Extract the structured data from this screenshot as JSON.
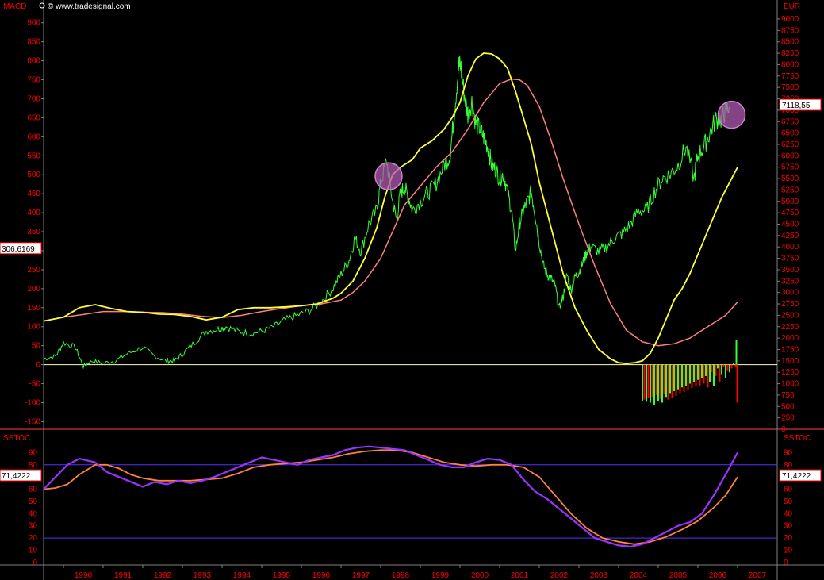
{
  "watermark": "© www.tradesignal.com",
  "colors": {
    "background": "#000000",
    "axis_text": "#ff0000",
    "price": "#33ff33",
    "macd": "#ffff33",
    "macd_signal": "#ff7f7f",
    "histogram_pos": "#33ff33",
    "histogram_neg": "#ff0000",
    "zero_line": "#ffffbb",
    "stoch_k": "#9933ff",
    "stoch_d": "#ff8040",
    "stoch_bands": "#5533ff",
    "highlight": "#b05ab0"
  },
  "top_panel": {
    "left_title": "MACD",
    "right_title": "EUR",
    "left_readout": "306,6169",
    "right_readout": "7118,55",
    "left_ticks": [
      "900",
      "850",
      "800",
      "750",
      "700",
      "650",
      "600",
      "550",
      "500",
      "450",
      "400",
      "350",
      "300",
      "250",
      "200",
      "150",
      "100",
      "50",
      "0",
      "-50",
      "-100",
      "-150"
    ],
    "right_ticks": [
      "9000",
      "8750",
      "8500",
      "8250",
      "8000",
      "7750",
      "7500",
      "7250",
      "7000",
      "6750",
      "6500",
      "6250",
      "6000",
      "5750",
      "5500",
      "5250",
      "5000",
      "4750",
      "4500",
      "4250",
      "4000",
      "3750",
      "3500",
      "3250",
      "3000",
      "2750",
      "2500",
      "2250",
      "2000",
      "1750",
      "1500",
      "1250",
      "1000",
      "750",
      "500",
      "250",
      "0"
    ]
  },
  "bottom_panel": {
    "left_title": "SSTOC",
    "right_title": "SSTOC",
    "left_readout": "71,4222",
    "right_readout": "71,4222",
    "ticks": [
      "90",
      "80",
      "70",
      "60",
      "50",
      "40",
      "30",
      "20",
      "10",
      "0"
    ]
  },
  "x_axis": {
    "years": [
      "1990",
      "1991",
      "1992",
      "1993",
      "1994",
      "1995",
      "1996",
      "1997",
      "1998",
      "1999",
      "2000",
      "2001",
      "2002",
      "2003",
      "2004",
      "2005",
      "2006",
      "2007"
    ]
  },
  "chart_data": [
    {
      "type": "line",
      "name": "top",
      "x_range": [
        1989.5,
        2008.0
      ],
      "y_left_range": [
        -170,
        960
      ],
      "y_right_range": [
        0,
        9000
      ],
      "price_series": {
        "axis": "right",
        "x": [
          1989.5,
          1989.8,
          1990.0,
          1990.3,
          1990.5,
          1990.7,
          1991.0,
          1991.3,
          1991.6,
          1992.0,
          1992.3,
          1992.6,
          1992.8,
          1993.0,
          1993.3,
          1993.6,
          1993.9,
          1994.1,
          1994.4,
          1994.7,
          1995.0,
          1995.3,
          1995.6,
          1995.9,
          1996.2,
          1996.5,
          1996.8,
          1997.0,
          1997.2,
          1997.35,
          1997.5,
          1997.7,
          1997.9,
          1998.0,
          1998.15,
          1998.3,
          1998.4,
          1998.5,
          1998.6,
          1998.7,
          1998.8,
          1999.0,
          1999.2,
          1999.4,
          1999.6,
          1999.75,
          1999.85,
          1999.95,
          2000.0,
          2000.1,
          2000.2,
          2000.3,
          2000.4,
          2000.5,
          2000.6,
          2000.7,
          2000.8,
          2000.9,
          2001.0,
          2001.1,
          2001.2,
          2001.3,
          2001.4,
          2001.5,
          2001.6,
          2001.7,
          2001.8,
          2001.9,
          2002.0,
          2002.1,
          2002.2,
          2002.3,
          2002.4,
          2002.5,
          2002.6,
          2002.7,
          2002.8,
          2002.9,
          2003.0,
          2003.1,
          2003.2,
          2003.3,
          2003.5,
          2003.7,
          2003.9,
          2004.1,
          2004.3,
          2004.5,
          2004.7,
          2004.9,
          2005.1,
          2005.3,
          2005.5,
          2005.7,
          2005.9,
          2006.0,
          2006.15,
          2006.3,
          2006.45,
          2006.6,
          2006.7,
          2006.8,
          2006.9,
          2006.95,
          2007.0
        ],
        "y": [
          1550,
          1600,
          1900,
          1800,
          1380,
          1500,
          1450,
          1500,
          1650,
          1800,
          1600,
          1500,
          1500,
          1650,
          1900,
          2150,
          2200,
          2250,
          2150,
          2100,
          2150,
          2250,
          2400,
          2500,
          2600,
          2800,
          3100,
          3400,
          3700,
          4200,
          3900,
          4500,
          4800,
          5400,
          5900,
          5000,
          4600,
          5200,
          5300,
          5100,
          4800,
          5000,
          5200,
          5400,
          5800,
          6000,
          6900,
          7800,
          8100,
          7400,
          6900,
          7200,
          6700,
          6600,
          6400,
          6200,
          5800,
          5700,
          5500,
          5600,
          5200,
          4800,
          3900,
          4500,
          4800,
          5000,
          5200,
          4700,
          4100,
          3600,
          3400,
          3300,
          3150,
          2650,
          2900,
          3400,
          3050,
          3350,
          3450,
          3650,
          3900,
          4000,
          3900,
          4000,
          4200,
          4300,
          4500,
          4800,
          4800,
          5200,
          5500,
          5600,
          5800,
          6200,
          5500,
          6000,
          6200,
          6500,
          6800,
          6800,
          7000,
          7118
        ]
      },
      "macd_series": {
        "axis": "left",
        "x": [
          1989.5,
          1990.0,
          1990.4,
          1990.8,
          1991.2,
          1991.6,
          1992.0,
          1992.4,
          1992.8,
          1993.2,
          1993.6,
          1994.0,
          1994.4,
          1994.8,
          1995.2,
          1995.6,
          1996.0,
          1996.4,
          1996.8,
          1997.0,
          1997.3,
          1997.6,
          1997.9,
          1998.1,
          1998.3,
          1998.5,
          1998.8,
          1999.0,
          1999.3,
          1999.6,
          1999.8,
          2000.0,
          2000.2,
          2000.4,
          2000.6,
          2000.8,
          2001.0,
          2001.2,
          2001.4,
          2001.6,
          2001.8,
          2002.0,
          2002.3,
          2002.6,
          2002.9,
          2003.2,
          2003.5,
          2003.8,
          2004.0,
          2004.2,
          2004.4,
          2004.6,
          2004.8,
          2005.0,
          2005.2,
          2005.4,
          2005.6,
          2005.8,
          2006.0,
          2006.2,
          2006.4,
          2006.6,
          2006.8,
          2007.0
        ],
        "y": [
          115,
          125,
          150,
          158,
          148,
          140,
          138,
          133,
          132,
          127,
          118,
          125,
          145,
          150,
          150,
          152,
          155,
          160,
          175,
          188,
          220,
          280,
          360,
          440,
          500,
          520,
          540,
          570,
          590,
          620,
          650,
          690,
          760,
          805,
          820,
          818,
          805,
          780,
          720,
          650,
          580,
          480,
          360,
          240,
          150,
          90,
          40,
          15,
          5,
          3,
          5,
          10,
          30,
          70,
          120,
          170,
          200,
          240,
          290,
          340,
          390,
          440,
          480,
          520
        ]
      },
      "signal_series": {
        "axis": "left",
        "x": [
          1989.5,
          1990.0,
          1990.5,
          1991.0,
          1991.5,
          1992.0,
          1992.5,
          1993.0,
          1993.5,
          1994.0,
          1994.5,
          1995.0,
          1995.5,
          1996.0,
          1996.5,
          1997.0,
          1997.3,
          1997.6,
          1998.0,
          1998.3,
          1998.6,
          1999.0,
          1999.4,
          1999.8,
          2000.2,
          2000.6,
          2001.0,
          2001.3,
          2001.5,
          2001.7,
          2002.0,
          2002.3,
          2002.6,
          2003.0,
          2003.4,
          2003.8,
          2004.2,
          2004.6,
          2005.0,
          2005.4,
          2005.8,
          2006.1,
          2006.4,
          2006.7,
          2007.0
        ],
        "y": [
          115,
          125,
          132,
          140,
          140,
          138,
          137,
          133,
          127,
          124,
          130,
          140,
          148,
          155,
          160,
          170,
          190,
          220,
          280,
          350,
          420,
          470,
          520,
          560,
          620,
          690,
          740,
          752,
          750,
          735,
          680,
          590,
          490,
          370,
          260,
          160,
          90,
          60,
          50,
          55,
          70,
          90,
          110,
          130,
          165
        ]
      },
      "histogram": {
        "axis": "left",
        "x": [
          2004.6,
          2004.65,
          2004.7,
          2004.75,
          2004.8,
          2004.85,
          2004.9,
          2004.95,
          2005.0,
          2005.05,
          2005.1,
          2005.15,
          2005.2,
          2005.25,
          2005.3,
          2005.35,
          2005.4,
          2005.45,
          2005.5,
          2005.55,
          2005.6,
          2005.65,
          2005.7,
          2005.75,
          2005.8,
          2005.85,
          2005.9,
          2005.95,
          2006.0,
          2006.05,
          2006.1,
          2006.15,
          2006.2,
          2006.25,
          2006.3,
          2006.35,
          2006.4,
          2006.45,
          2006.5,
          2006.55,
          2006.6,
          2006.65,
          2006.7,
          2006.75,
          2006.8,
          2006.85,
          2006.9,
          2006.95,
          2006.97,
          2006.99
        ],
        "y": [
          -95,
          -92,
          -98,
          -88,
          -100,
          -85,
          -105,
          -80,
          -95,
          -90,
          -100,
          -78,
          -85,
          -92,
          -75,
          -88,
          -70,
          -82,
          -65,
          -75,
          -60,
          -72,
          -55,
          -68,
          -50,
          -62,
          -45,
          -58,
          -40,
          -55,
          -35,
          -50,
          -30,
          -60,
          -45,
          -20,
          -55,
          -30,
          -10,
          -45,
          -25,
          -5,
          -35,
          -15,
          -20,
          -10,
          5,
          -5,
          65,
          -100
        ]
      }
    },
    {
      "type": "line",
      "name": "bottom",
      "x_range": [
        1989.5,
        2008.0
      ],
      "y_range": [
        -2,
        100
      ],
      "bands": [
        80,
        20
      ],
      "k_series": {
        "x": [
          1989.5,
          1989.8,
          1990.1,
          1990.4,
          1990.8,
          1991.1,
          1991.4,
          1991.7,
          1992.0,
          1992.3,
          1992.6,
          1992.9,
          1993.2,
          1993.5,
          1993.8,
          1994.1,
          1994.4,
          1994.7,
          1995.0,
          1995.3,
          1995.6,
          1995.9,
          1996.2,
          1996.5,
          1996.8,
          1997.1,
          1997.4,
          1997.7,
          1998.0,
          1998.3,
          1998.6,
          1998.9,
          1999.2,
          1999.5,
          1999.8,
          2000.1,
          2000.4,
          2000.7,
          2001.0,
          2001.3,
          2001.6,
          2001.9,
          2002.2,
          2002.5,
          2002.8,
          2003.1,
          2003.4,
          2003.7,
          2004.0,
          2004.3,
          2004.6,
          2004.9,
          2005.2,
          2005.5,
          2005.8,
          2006.1,
          2006.4,
          2006.7,
          2007.0
        ],
        "y": [
          60,
          70,
          80,
          85,
          82,
          74,
          70,
          66,
          62,
          66,
          64,
          67,
          65,
          67,
          70,
          74,
          78,
          82,
          86,
          84,
          82,
          80,
          84,
          86,
          88,
          92,
          94,
          95,
          94,
          93,
          92,
          88,
          84,
          80,
          78,
          78,
          82,
          85,
          84,
          80,
          68,
          58,
          52,
          44,
          36,
          28,
          20,
          17,
          14,
          13,
          15,
          20,
          25,
          30,
          33,
          40,
          55,
          72,
          90
        ]
      },
      "d_series": {
        "x": [
          1989.5,
          1989.8,
          1990.1,
          1990.4,
          1990.8,
          1991.1,
          1991.4,
          1991.7,
          1992.0,
          1992.4,
          1992.8,
          1993.2,
          1993.6,
          1994.0,
          1994.4,
          1994.8,
          1995.2,
          1995.6,
          1996.0,
          1996.4,
          1996.8,
          1997.2,
          1997.6,
          1998.0,
          1998.4,
          1998.8,
          1999.2,
          1999.6,
          2000.0,
          2000.4,
          2000.8,
          2001.2,
          2001.6,
          2002.0,
          2002.4,
          2002.8,
          2003.2,
          2003.6,
          2004.0,
          2004.4,
          2004.8,
          2005.2,
          2005.6,
          2006.0,
          2006.4,
          2006.7,
          2007.0
        ],
        "y": [
          60,
          61,
          64,
          72,
          80,
          80,
          77,
          72,
          69,
          67,
          67,
          67,
          68,
          69,
          73,
          78,
          80,
          81,
          82,
          84,
          86,
          89,
          91,
          92,
          92,
          90,
          86,
          82,
          80,
          79,
          80,
          80,
          78,
          70,
          55,
          40,
          28,
          20,
          17,
          15,
          17,
          21,
          27,
          34,
          45,
          55,
          70
        ]
      }
    }
  ]
}
